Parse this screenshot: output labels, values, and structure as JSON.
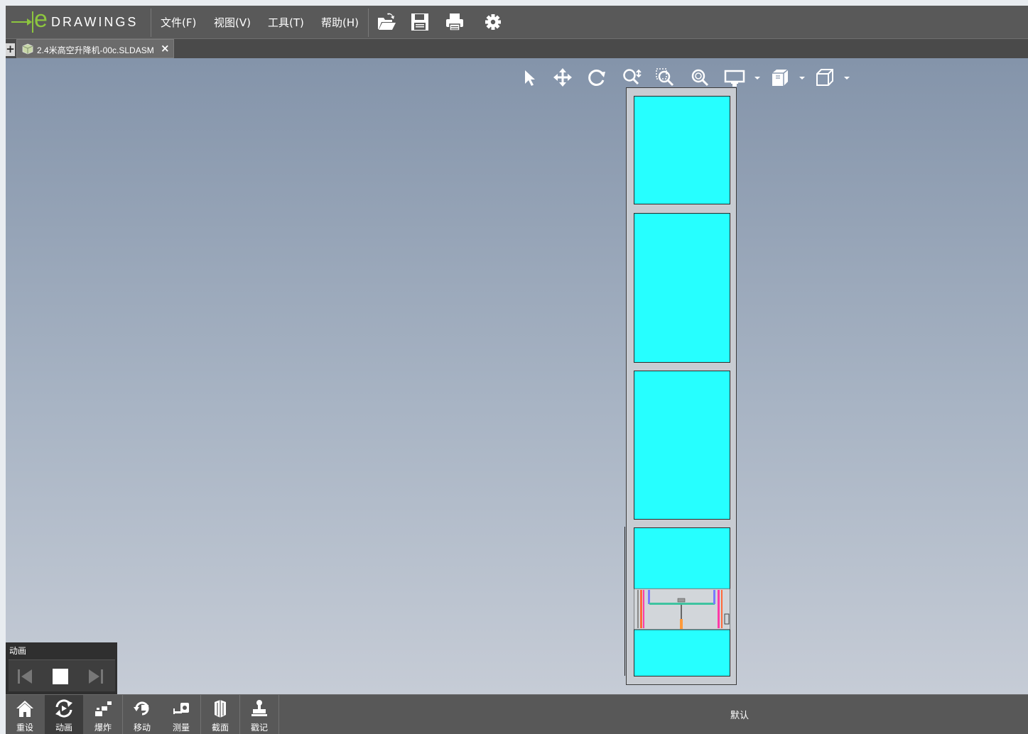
{
  "app": {
    "logo_text": "DRAWINGS",
    "logo_letter": "e"
  },
  "menu": {
    "items": [
      "文件(F)",
      "视图(V)",
      "工具(T)",
      "帮助(H)"
    ],
    "icons": [
      "open-folder-icon",
      "save-icon",
      "print-icon",
      "settings-gear-icon"
    ]
  },
  "tabs": {
    "add_label": "+",
    "active_title": "2.4米高空升降机-00c.SLDASM",
    "close_label": "×"
  },
  "view_toolbar": {
    "icons": [
      "select-arrow-icon",
      "pan-icon",
      "rotate-icon",
      "zoom-to-fit-icon",
      "zoom-to-area-icon",
      "zoom-icon",
      "display-style-icon",
      "section-view-icon",
      "view-orientation-cube-icon"
    ]
  },
  "animation_panel": {
    "title": "动画",
    "controls": [
      "previous-icon",
      "stop-icon",
      "next-icon"
    ]
  },
  "bottom_toolbar": {
    "buttons": [
      {
        "label": "重设",
        "icon": "home-icon"
      },
      {
        "label": "动画",
        "icon": "animate-icon",
        "active": true
      },
      {
        "label": "爆炸",
        "icon": "explode-icon"
      },
      {
        "label": "移动",
        "icon": "move-icon"
      },
      {
        "label": "测量",
        "icon": "measure-icon"
      },
      {
        "label": "截面",
        "icon": "section-icon"
      },
      {
        "label": "戳记",
        "icon": "stamp-icon"
      }
    ],
    "configuration": "默认"
  },
  "colors": {
    "brand_green": "#8dc63f",
    "panel_cyan": "#26ffff",
    "toolbar_bg": "#595959"
  }
}
